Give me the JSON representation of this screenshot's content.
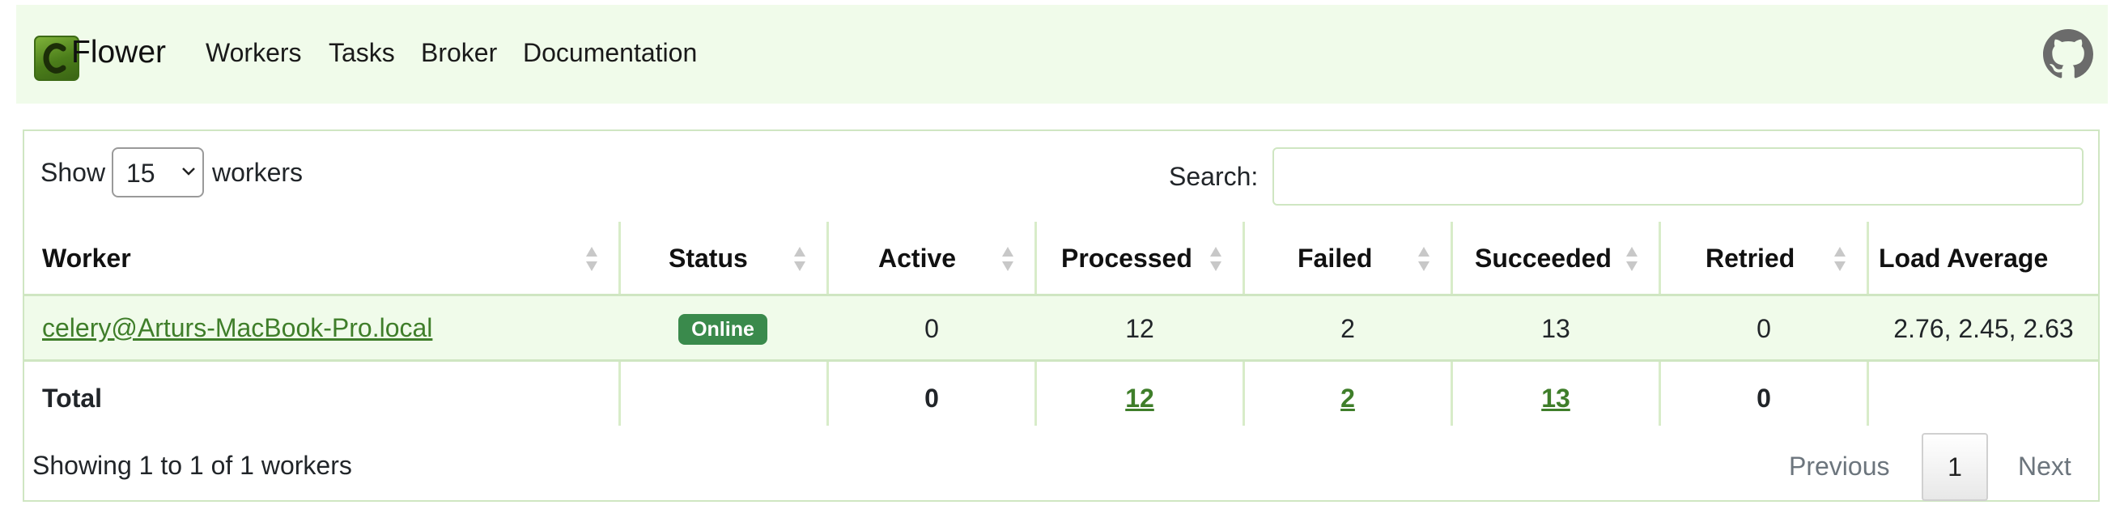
{
  "navbar": {
    "brand": "Flower",
    "logo_letter": "C",
    "links": [
      "Workers",
      "Tasks",
      "Broker",
      "Documentation"
    ],
    "github_icon": "github-icon"
  },
  "controls": {
    "show_label": "Show",
    "page_size": "15",
    "workers_label": "workers",
    "search_label": "Search:",
    "search_value": ""
  },
  "table": {
    "headers": [
      "Worker",
      "Status",
      "Active",
      "Processed",
      "Failed",
      "Succeeded",
      "Retried",
      "Load Average"
    ],
    "rows": [
      {
        "worker": "celery@Arturs-MacBook-Pro.local",
        "status": "Online",
        "active": "0",
        "processed": "12",
        "failed": "2",
        "succeeded": "13",
        "retried": "0",
        "load_average": "2.76, 2.45, 2.63"
      }
    ],
    "total": {
      "label": "Total",
      "active": "0",
      "processed": "12",
      "failed": "2",
      "succeeded": "13",
      "retried": "0"
    }
  },
  "footer": {
    "info": "Showing 1 to 1 of 1 workers",
    "previous": "Previous",
    "current_page": "1",
    "next": "Next"
  },
  "colors": {
    "navbar_bg": "#f0fbea",
    "row_bg": "#f0fbea",
    "link": "#3f7e2a",
    "badge": "#3a8a4c"
  }
}
